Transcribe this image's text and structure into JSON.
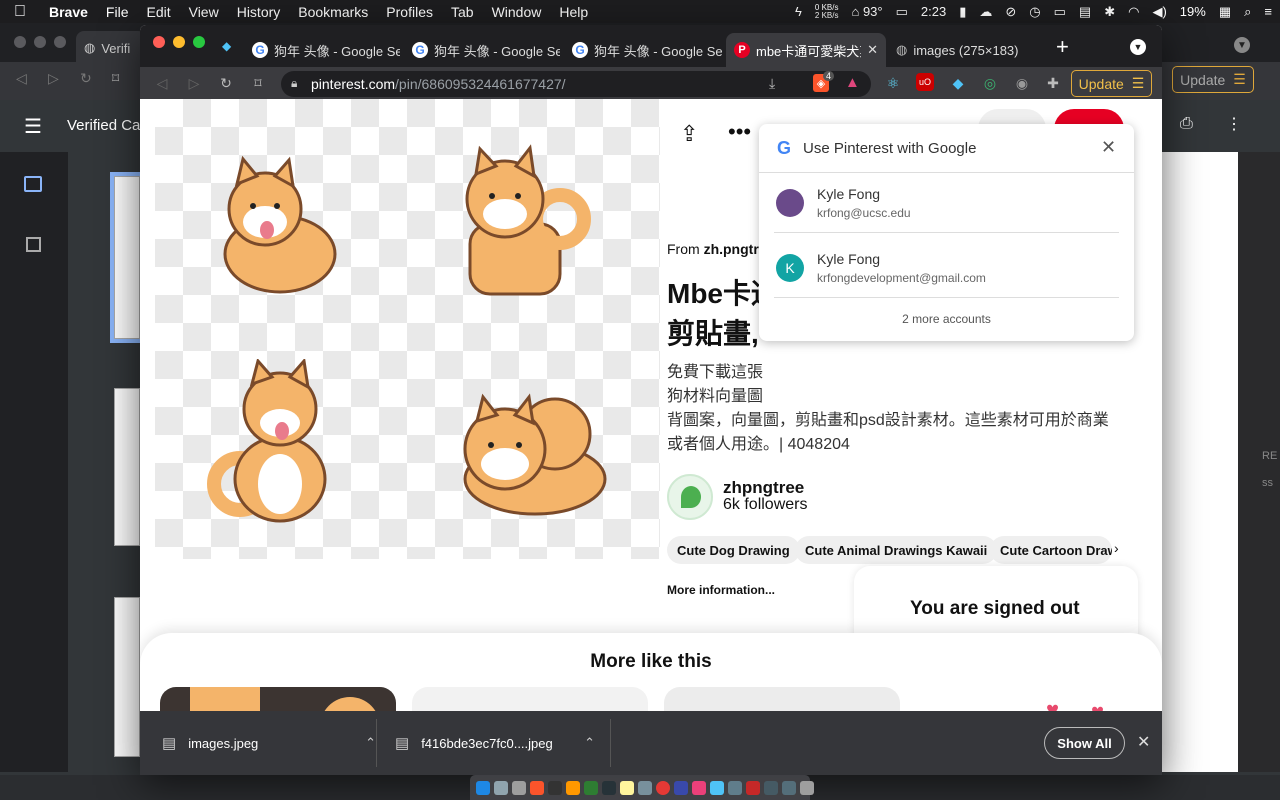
{
  "menubar": {
    "app": "Brave",
    "items": [
      "File",
      "Edit",
      "View",
      "History",
      "Bookmarks",
      "Profiles",
      "Tab",
      "Window",
      "Help"
    ],
    "net_up": "0 KB/s",
    "net_down": "2 KB/s",
    "temp": "93°",
    "time": "2:23",
    "battery": "19%"
  },
  "bg_window": {
    "title": "Verified Ca",
    "tab_label": "Verifi",
    "update_label": "Update",
    "side_labels": [
      "RE",
      "ss"
    ]
  },
  "tabs": [
    {
      "label": "狗年 头像 - Google Se",
      "icon": "google-icon"
    },
    {
      "label": "狗年 头像 - Google Se",
      "icon": "google-icon"
    },
    {
      "label": "狗年 头像 - Google Se",
      "icon": "google-icon"
    },
    {
      "label": "mbe卡通可愛柴犬剪",
      "icon": "pinterest-icon",
      "active": true
    },
    {
      "label": "images (275×183)",
      "icon": "globe-icon"
    }
  ],
  "toolbar": {
    "url_domain": "pinterest.com",
    "url_path": "/pin/686095324461677427/",
    "shield_count": "4",
    "update_label": "Update"
  },
  "pin": {
    "from_label": "From",
    "from_site": "zh.pngtr",
    "title_line1": "Mbe卡通",
    "title_line2": "剪貼畫,",
    "desc_line1": "免費下載這張",
    "desc_line2": "狗材料向量圖",
    "desc_line3": "背圖案，向量圖，剪貼畫和psd設計素材。這些素材可用於商業",
    "desc_line4": "或者個人用途。| 4048204",
    "creator_name": "zhpngtree",
    "creator_followers": "6k followers",
    "chips": [
      "Cute Dog Drawing",
      "Cute Animal Drawings Kawaii",
      "Cute Cartoon Draw"
    ],
    "more_info": "More information...",
    "signed_out": "You are signed out"
  },
  "more_like_this": "More like this",
  "google_popup": {
    "title": "Use Pinterest with Google",
    "accounts": [
      {
        "name": "Kyle Fong",
        "email": "krfong@ucsc.edu",
        "initial": ""
      },
      {
        "name": "Kyle Fong",
        "email": "krfongdevelopment@gmail.com",
        "initial": "K"
      }
    ],
    "more_accounts": "2 more accounts",
    "colors": {
      "avatar2": "#12a4a4"
    }
  },
  "downloads": {
    "items": [
      "images.jpeg",
      "f416bde3ec7fc0....jpeg"
    ],
    "show_all": "Show All"
  },
  "colors": {
    "pinterest_red": "#e60023",
    "update_orange": "#e0a83a"
  }
}
